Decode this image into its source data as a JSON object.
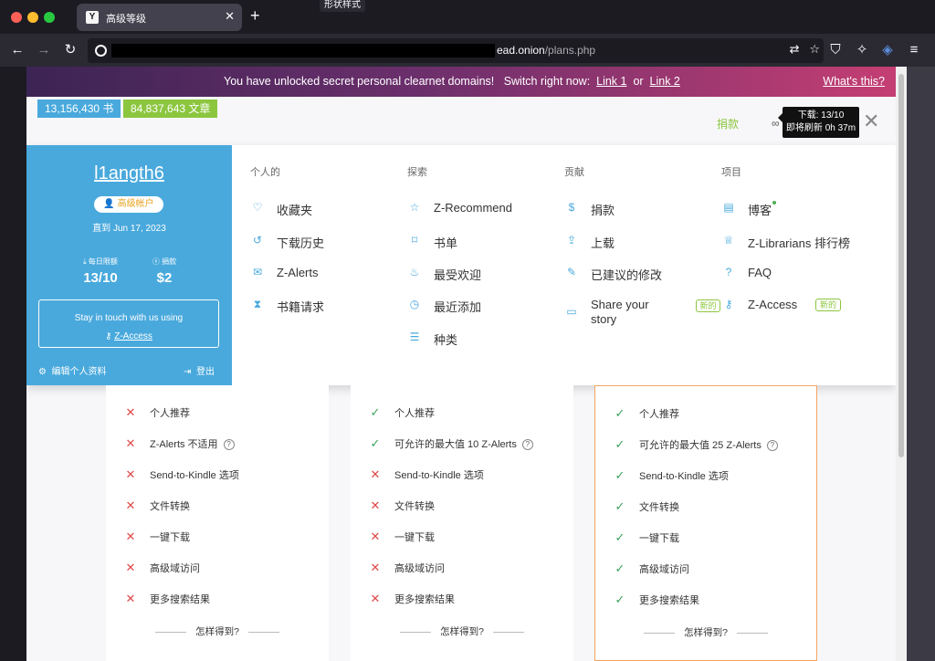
{
  "browser": {
    "tab_title": "高级等级",
    "tooltip": "形状样式",
    "url_domain": "ead.onion",
    "url_path": "/plans.php"
  },
  "banner": {
    "message": "You have unlocked secret personal clearnet domains!",
    "switch_text": "Switch right now:",
    "link1": "Link 1",
    "or": "or",
    "link2": "Link 2",
    "whats_this": "What's this?"
  },
  "stats": {
    "books": "13,156,430 书",
    "articles": "84,837,643 文章"
  },
  "topbar": {
    "donate": "捐款",
    "tooltip_line1": "下载: 13/10",
    "tooltip_line2": "即将刷新 0h 37m"
  },
  "profile": {
    "username": "l1angth6",
    "badge": "高级帐户",
    "until": "直到 Jun 17, 2023",
    "daily_label": "每日限额",
    "daily_value": "13/10",
    "donation_label": "捐款",
    "donation_value": "$2",
    "stay_text": "Stay in touch with us using",
    "stay_link": "Z-Access",
    "edit": "编辑个人资料",
    "logout": "登出"
  },
  "menu": {
    "personal": {
      "title": "个人的",
      "items": [
        "收藏夹",
        "下载历史",
        "Z-Alerts",
        "书籍请求"
      ]
    },
    "explore": {
      "title": "探索",
      "items": [
        "Z-Recommend",
        "书单",
        "最受欢迎",
        "最近添加",
        "种类"
      ]
    },
    "contribute": {
      "title": "贡献",
      "items": [
        "捐款",
        "上载",
        "已建议的修改",
        "Share your story"
      ]
    },
    "projects": {
      "title": "项目",
      "items": [
        "博客",
        "Z-Librarians 排行榜",
        "FAQ",
        "Z-Access"
      ]
    },
    "new_badge": "新的"
  },
  "plans": {
    "features": [
      "个人推荐",
      "Send-to-Kindle 选项",
      "文件转换",
      "一键下载",
      "高级域访问",
      "更多搜索结果"
    ],
    "alerts": [
      "Z-Alerts 不适用",
      "可允许的最大值 10 Z-Alerts",
      "可允许的最大值 25 Z-Alerts"
    ],
    "how": "怎样得到?"
  }
}
